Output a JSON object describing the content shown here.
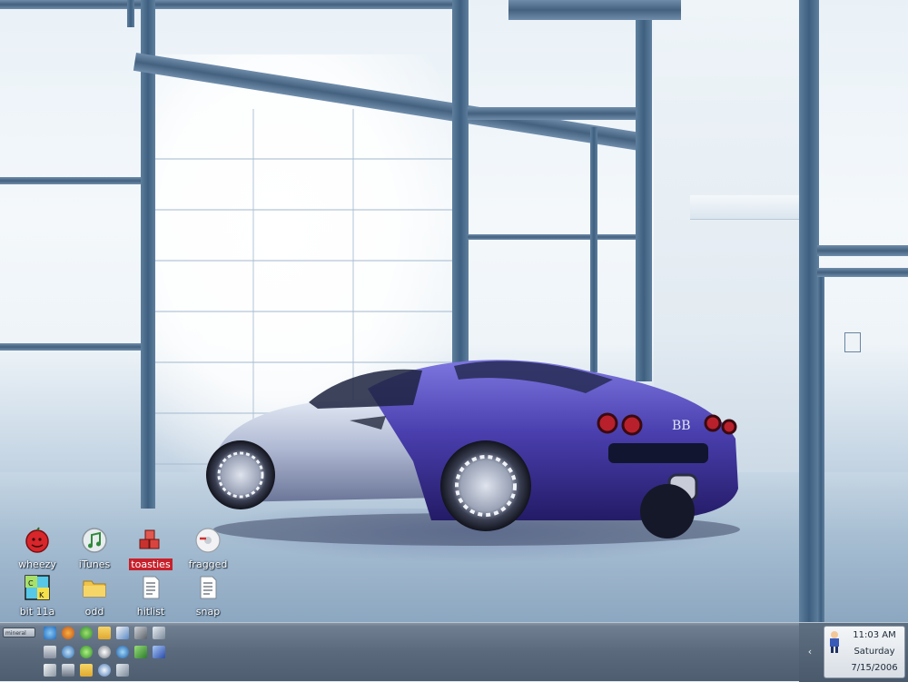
{
  "desktop": {
    "icons": [
      {
        "label": "wheezy",
        "icon": "red-tomato-icon",
        "selected": false
      },
      {
        "label": "iTunes",
        "icon": "itunes-icon",
        "selected": false
      },
      {
        "label": "toasties",
        "icon": "red-cubes-icon",
        "selected": true
      },
      {
        "label": "fragged",
        "icon": "disc-icon",
        "selected": false
      },
      {
        "label": "bit 11a",
        "icon": "bitcomet-icon",
        "selected": false
      },
      {
        "label": "odd",
        "icon": "folder-icon",
        "selected": false
      },
      {
        "label": "hitlist",
        "icon": "text-file-icon",
        "selected": false
      },
      {
        "label": "snap",
        "icon": "text-file-icon",
        "selected": false
      }
    ]
  },
  "taskbar": {
    "start_label": "mineral",
    "quick_launch": [
      "internet-explorer-icon",
      "firefox-icon",
      "power-icon",
      "folder-icon",
      "windows-media-icon",
      "tools-icon",
      "network-icon",
      "printer-icon",
      "browser-icon",
      "media-player-icon",
      "stop-icon",
      "globe-icon",
      "excel-icon",
      "word-icon",
      "document-icon",
      "drive-icon",
      "folder-icon",
      "help-icon",
      "network-icon"
    ],
    "clock": {
      "time": "11:03 AM",
      "day": "Saturday",
      "date": "7/15/2006"
    },
    "tray_arrow": "‹"
  },
  "colors": {
    "selection": "#c8202a",
    "taskbar": "#5a6a7c",
    "car_body": "#4a3fae"
  }
}
